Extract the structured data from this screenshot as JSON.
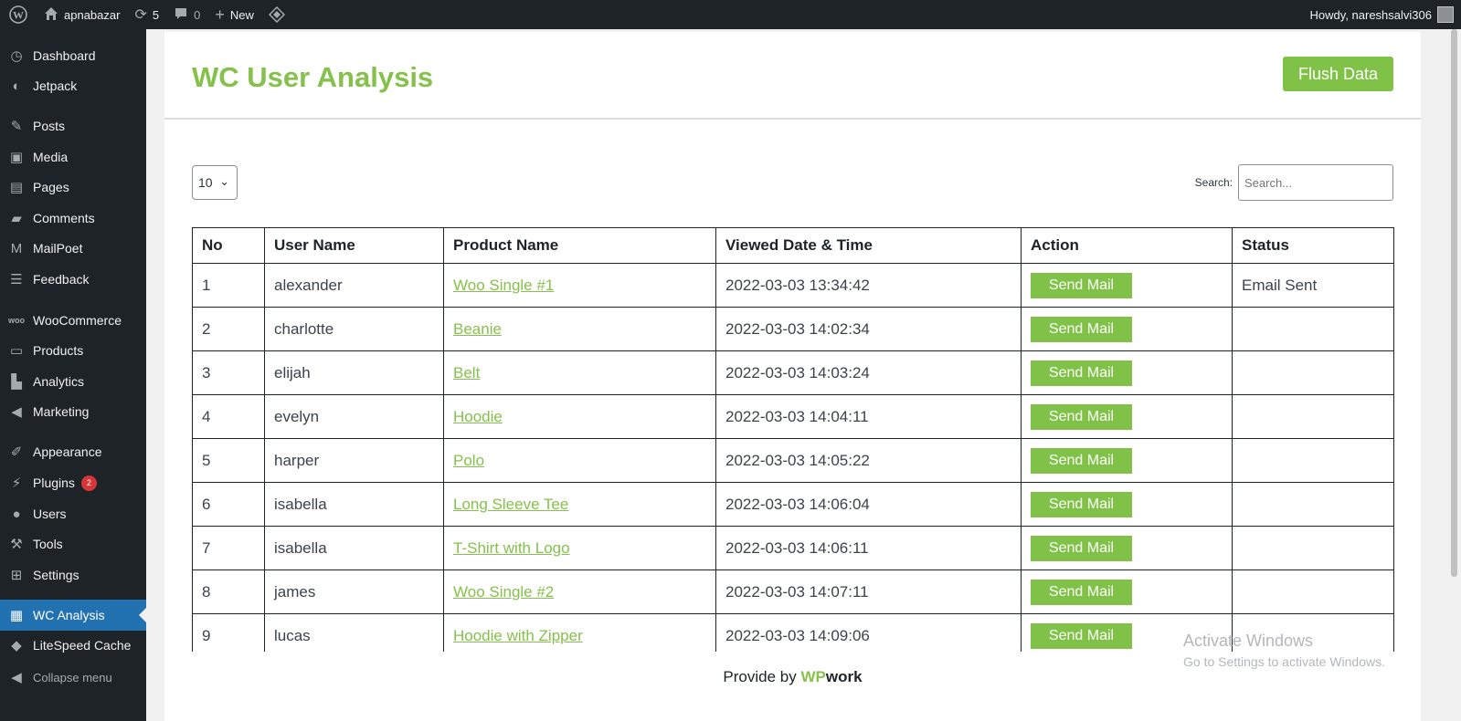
{
  "adminbar": {
    "site_name": "apnabazar",
    "updates_count": "5",
    "comments_count": "0",
    "new_label": "New",
    "greeting": "Howdy, nareshsalvi306"
  },
  "sidebar": {
    "items": [
      {
        "label": "Dashboard",
        "icon": "dashboard-icon"
      },
      {
        "label": "Jetpack",
        "icon": "jetpack-icon"
      },
      {
        "label": "Posts",
        "icon": "pin-icon"
      },
      {
        "label": "Media",
        "icon": "media-icon"
      },
      {
        "label": "Pages",
        "icon": "pages-icon"
      },
      {
        "label": "Comments",
        "icon": "comment-icon"
      },
      {
        "label": "MailPoet",
        "icon": "mailpoet-icon"
      },
      {
        "label": "Feedback",
        "icon": "feedback-icon"
      },
      {
        "label": "WooCommerce",
        "icon": "woo-icon"
      },
      {
        "label": "Products",
        "icon": "products-icon"
      },
      {
        "label": "Analytics",
        "icon": "bar-chart-icon"
      },
      {
        "label": "Marketing",
        "icon": "megaphone-icon"
      },
      {
        "label": "Appearance",
        "icon": "brush-icon"
      },
      {
        "label": "Plugins",
        "icon": "plugin-icon",
        "badge": "2"
      },
      {
        "label": "Users",
        "icon": "user-icon"
      },
      {
        "label": "Tools",
        "icon": "wrench-icon"
      },
      {
        "label": "Settings",
        "icon": "settings-icon"
      },
      {
        "label": "WC Analysis",
        "icon": "id-card-icon",
        "active": true
      },
      {
        "label": "LiteSpeed Cache",
        "icon": "litespeed-icon"
      }
    ],
    "collapse_label": "Collapse menu"
  },
  "main": {
    "title": "WC User Analysis",
    "flush_button": "Flush Data",
    "page_length": "10",
    "search_label": "Search:",
    "search_placeholder": "Search...",
    "columns": [
      "No",
      "User Name",
      "Product Name",
      "Viewed Date & Time",
      "Action",
      "Status"
    ],
    "rows": [
      {
        "no": "1",
        "user": "alexander",
        "product": "Woo Single #1",
        "date": "2022-03-03 13:34:42",
        "action": "Send Mail",
        "status": "Email Sent"
      },
      {
        "no": "2",
        "user": "charlotte",
        "product": "Beanie",
        "date": "2022-03-03 14:02:34",
        "action": "Send Mail",
        "status": ""
      },
      {
        "no": "3",
        "user": "elijah",
        "product": "Belt",
        "date": "2022-03-03 14:03:24",
        "action": "Send Mail",
        "status": ""
      },
      {
        "no": "4",
        "user": "evelyn",
        "product": "Hoodie",
        "date": "2022-03-03 14:04:11",
        "action": "Send Mail",
        "status": ""
      },
      {
        "no": "5",
        "user": "harper",
        "product": "Polo",
        "date": "2022-03-03 14:05:22",
        "action": "Send Mail",
        "status": ""
      },
      {
        "no": "6",
        "user": "isabella",
        "product": "Long Sleeve Tee",
        "date": "2022-03-03 14:06:04",
        "action": "Send Mail",
        "status": ""
      },
      {
        "no": "7",
        "user": "isabella",
        "product": "T-Shirt with Logo",
        "date": "2022-03-03 14:06:11",
        "action": "Send Mail",
        "status": ""
      },
      {
        "no": "8",
        "user": "james",
        "product": "Woo Single #2",
        "date": "2022-03-03 14:07:11",
        "action": "Send Mail",
        "status": ""
      },
      {
        "no": "9",
        "user": "lucas",
        "product": "Hoodie with Zipper",
        "date": "2022-03-03 14:09:06",
        "action": "Send Mail",
        "status": ""
      }
    ],
    "footer_prefix": "Provide by",
    "footer_brand_wp": "WP",
    "footer_brand_work": "work"
  },
  "watermark": {
    "line1": "Activate Windows",
    "line2": "Go to Settings to activate Windows."
  },
  "colors": {
    "accent_green": "#80c147",
    "admin_dark": "#1d2327",
    "active_blue": "#2271b1",
    "badge_red": "#d63638"
  }
}
